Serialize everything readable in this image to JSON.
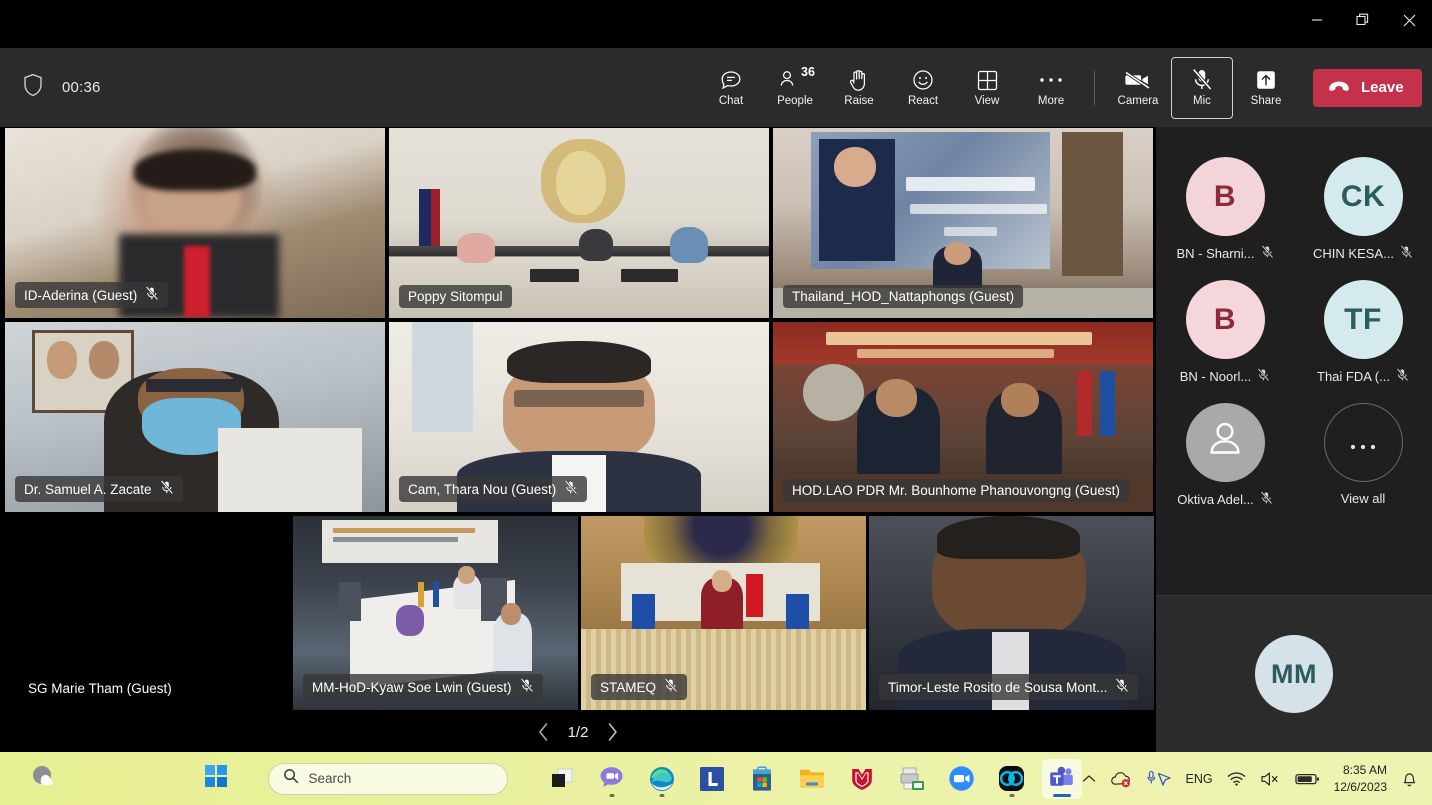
{
  "window": {
    "controls": [
      {
        "name": "minimize",
        "glyph": "minimize-icon"
      },
      {
        "name": "restore",
        "glyph": "restore-icon"
      },
      {
        "name": "close",
        "glyph": "close-icon"
      }
    ]
  },
  "toolbar": {
    "shield_icon": "shield-icon",
    "timer": "00:36",
    "items": [
      {
        "label": "Chat",
        "icon": "chat-icon",
        "badge": "",
        "state": "normal"
      },
      {
        "label": "People",
        "icon": "people-icon",
        "badge": "36",
        "state": "normal"
      },
      {
        "label": "Raise",
        "icon": "raise-hand-icon",
        "badge": "",
        "state": "normal"
      },
      {
        "label": "React",
        "icon": "react-smiley-icon",
        "badge": "",
        "state": "normal"
      },
      {
        "label": "View",
        "icon": "view-grid-icon",
        "badge": "",
        "state": "normal"
      },
      {
        "label": "More",
        "icon": "more-ellipsis-icon",
        "badge": "",
        "state": "normal"
      }
    ],
    "controls": [
      {
        "label": "Camera",
        "icon": "camera-off-icon",
        "state": "off"
      },
      {
        "label": "Mic",
        "icon": "mic-muted-icon",
        "state": "muted-focused"
      },
      {
        "label": "Share",
        "icon": "share-up-arrow-icon",
        "state": "normal"
      }
    ],
    "leave": {
      "label": "Leave",
      "icon": "hang-up-icon",
      "color": "#c4314b"
    }
  },
  "stage": {
    "tiles": [
      {
        "name": "ID-Aderina (Guest)",
        "muted": true,
        "active": false,
        "scene": "woman-dark-hair-glasses-red-lanyard",
        "row": 1
      },
      {
        "name": "Poppy Sitompul",
        "muted": false,
        "active": false,
        "scene": "conference-room-asean-secretariat",
        "row": 1
      },
      {
        "name": "Thailand_HOD_Nattaphongs (Guest)",
        "muted": false,
        "active": false,
        "scene": "thai-meeting-room-banner",
        "row": 1
      },
      {
        "name": "Dr. Samuel A. Zacate",
        "muted": true,
        "active": false,
        "scene": "man-blue-face-mask-office",
        "row": 2
      },
      {
        "name": "Cam, Thara Nou (Guest)",
        "muted": true,
        "active": false,
        "scene": "man-glasses-white-wall",
        "row": 2
      },
      {
        "name": "HOD.LAO PDR Mr. Bounhome Phanouvongng (Guest)",
        "muted": false,
        "active": true,
        "scene": "lao-pdr-meeting-room-banner-flags",
        "row": 2
      },
      {
        "name": "SG Marie Tham (Guest)",
        "muted": false,
        "active": false,
        "scene": "camera-off-black",
        "row": 3
      },
      {
        "name": "MM-HoD-Kyaw Soe Lwin (Guest)",
        "muted": true,
        "active": false,
        "scene": "myanmar-boardroom-table-flags",
        "row": 3
      },
      {
        "name": "STAMEQ",
        "muted": true,
        "active": false,
        "scene": "vietnam-room-woman-red-flag",
        "row": 3
      },
      {
        "name": "Timor-Leste Rosito de Sousa Mont...",
        "muted": true,
        "active": false,
        "scene": "man-dark-suit-indoor",
        "row": 3
      }
    ],
    "pagination": {
      "prev_icon": "chevron-left-icon",
      "page": "1/2",
      "next_icon": "chevron-right-icon"
    }
  },
  "roster": {
    "participants": [
      {
        "initials": "B",
        "name": "BN - Sharni...",
        "muted": true,
        "bg": "#f2d4d9",
        "fg": "#8e2a3c",
        "type": "initials"
      },
      {
        "initials": "CK",
        "name": "CHIN KESA...",
        "muted": true,
        "bg": "#d5eaec",
        "fg": "#2b5c5e",
        "type": "initials"
      },
      {
        "initials": "B",
        "name": "BN - Noorl...",
        "muted": true,
        "bg": "#f5d6da",
        "fg": "#8e2a3c",
        "type": "initials"
      },
      {
        "initials": "TF",
        "name": "Thai FDA (...",
        "muted": true,
        "bg": "#d5eaec",
        "fg": "#2b5c5e",
        "type": "initials"
      },
      {
        "initials": "",
        "name": "Oktiva Adel...",
        "muted": true,
        "bg": "#a9a9a9",
        "fg": "#ffffff",
        "type": "person-icon"
      },
      {
        "initials": "",
        "name": "View all",
        "muted": false,
        "bg": "transparent",
        "fg": "#e9e9e9",
        "type": "view-all"
      }
    ],
    "self": {
      "initials": "MM",
      "bg": "#d5e3e8",
      "fg": "#2b5c5e"
    }
  },
  "taskbar": {
    "weather_icon": "weather-cloud-icon",
    "start_icon": "windows-start-icon",
    "search": {
      "placeholder": "Search",
      "icon": "search-icon"
    },
    "apps": [
      {
        "name": "task-view",
        "label": "Task View",
        "running": false
      },
      {
        "name": "chat",
        "label": "Chat",
        "running": false
      },
      {
        "name": "edge",
        "label": "Microsoft Edge",
        "running": true
      },
      {
        "name": "l-app",
        "label": "L",
        "running": false
      },
      {
        "name": "store",
        "label": "Microsoft Store",
        "running": false
      },
      {
        "name": "file-explorer",
        "label": "File Explorer",
        "running": false
      },
      {
        "name": "mcafee",
        "label": "McAfee",
        "running": false
      },
      {
        "name": "printer-scan",
        "label": "Scanner",
        "running": false
      },
      {
        "name": "zoom",
        "label": "Zoom",
        "running": false
      },
      {
        "name": "webex",
        "label": "Webex",
        "running": true
      },
      {
        "name": "teams",
        "label": "Microsoft Teams",
        "running": true,
        "active": true
      }
    ],
    "tray": {
      "chevron": "chevron-up-icon",
      "onedrive_error": "cloud-error-icon",
      "mic_cursor": "mic-cursor-icon",
      "language": "ENG",
      "wifi": "wifi-icon",
      "volume": "speaker-muted-icon",
      "battery": "battery-icon",
      "time": "8:35 AM",
      "date": "12/6/2023",
      "notifications": "bell-icon"
    }
  }
}
